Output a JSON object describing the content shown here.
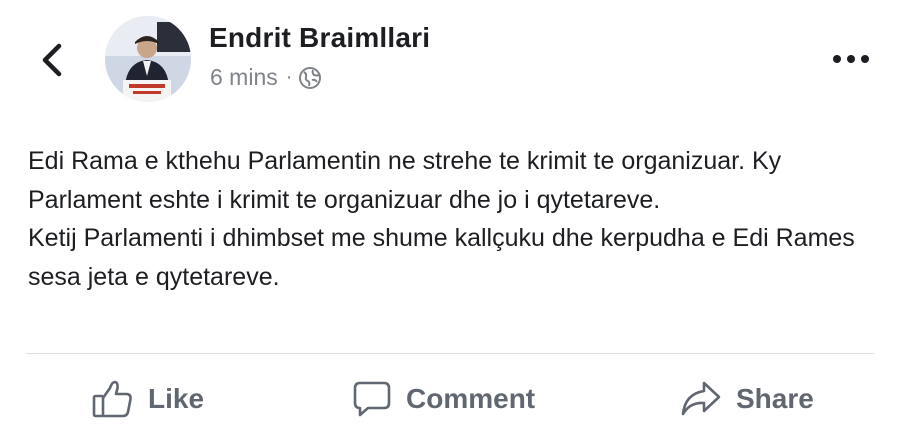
{
  "post": {
    "author": "Endrit Braimllari",
    "time": "6 mins",
    "separator": "·",
    "privacy_icon": "globe-icon",
    "paragraphs": [
      "Edi Rama e kthehu Parlamentin ne strehe te krimit te organizuar. Ky Parlament eshte i krimit te organizuar dhe jo i qytetareve.",
      "Ketij Parlamenti i dhimbset me shume kallçuku dhe kerpudha e Edi Rames sesa jeta e qytetareve."
    ]
  },
  "header": {
    "back_icon": "chevron-left-icon",
    "more_icon": "more-dots-icon"
  },
  "actions": {
    "like_label": "Like",
    "comment_label": "Comment",
    "share_label": "Share"
  },
  "colors": {
    "text": "#1c1e21",
    "meta": "#7f838a",
    "action": "#606770",
    "divider": "#dddfe2"
  }
}
